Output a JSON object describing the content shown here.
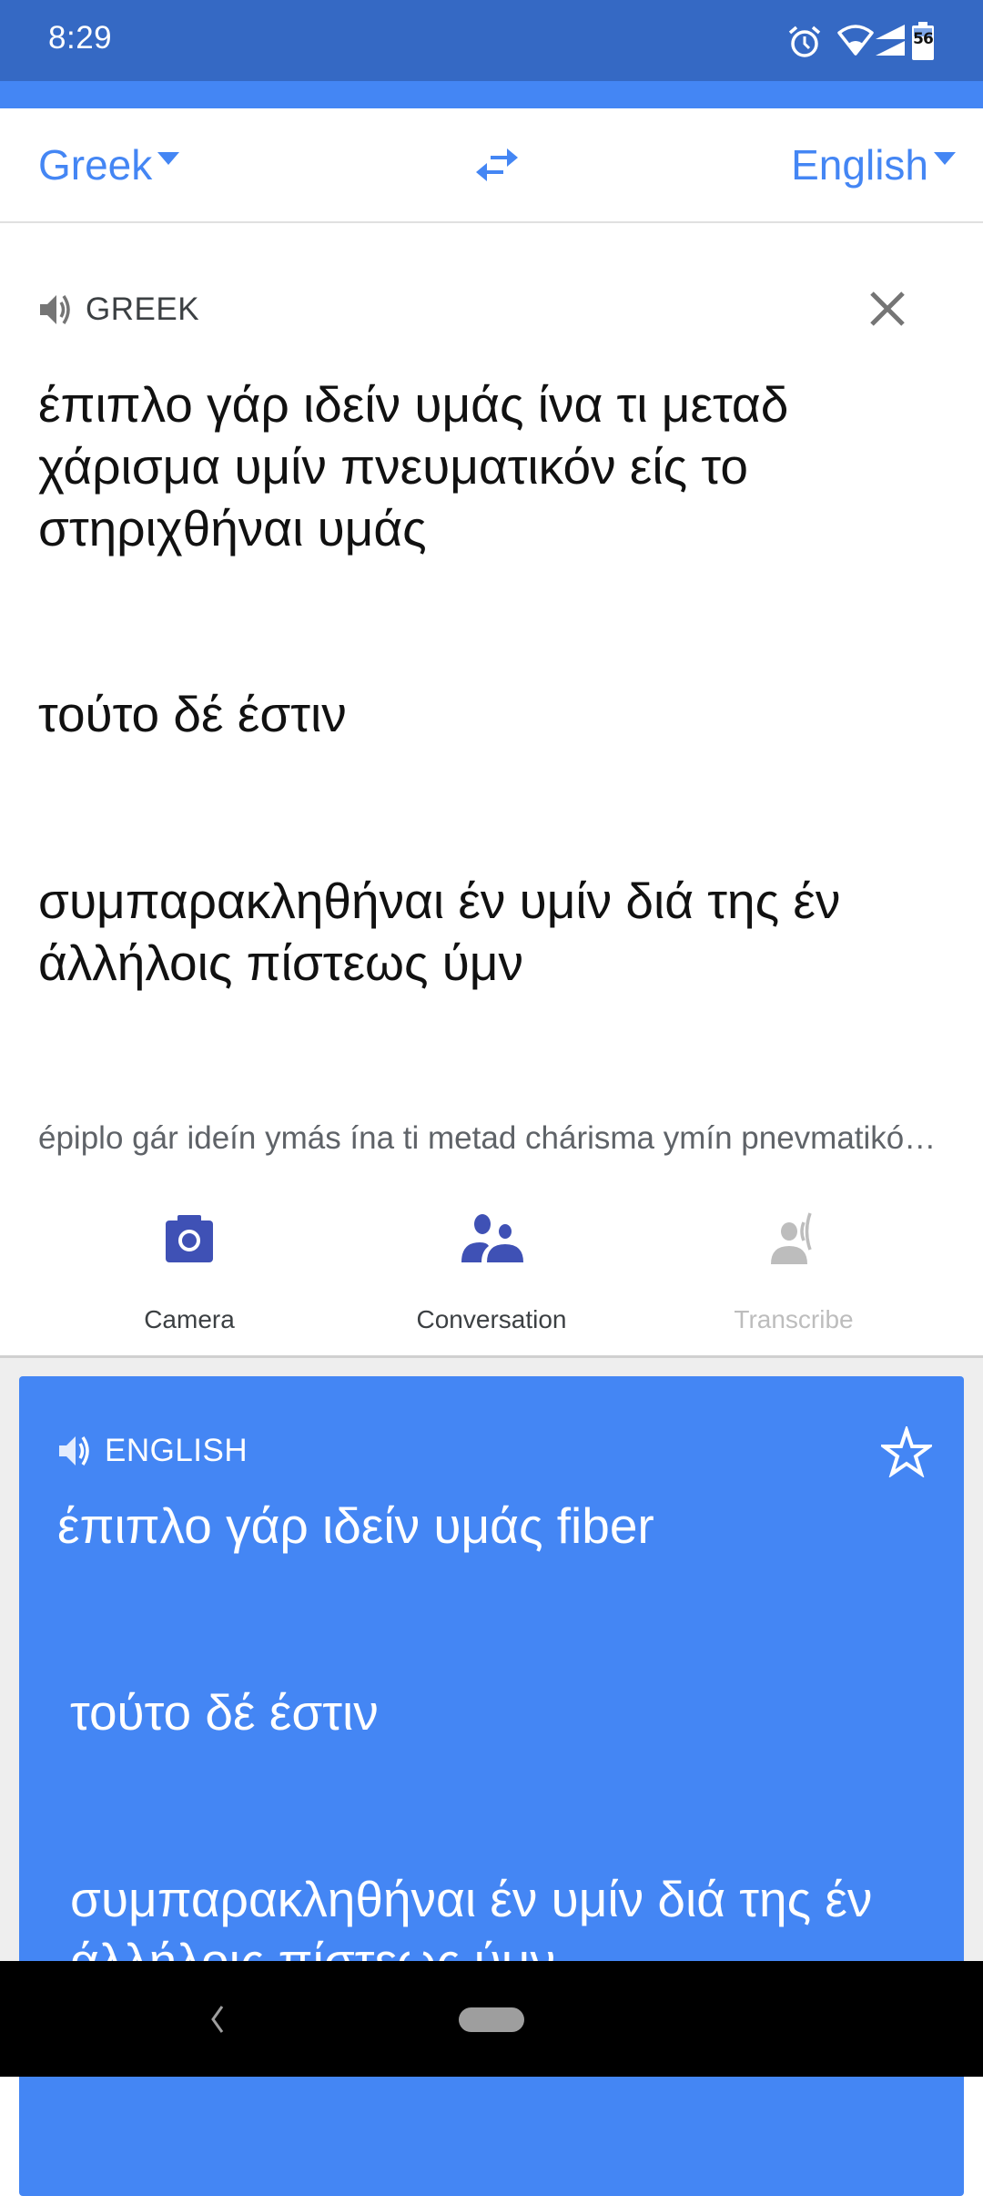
{
  "status_bar": {
    "time": "8:29",
    "battery_level": "56",
    "icons": [
      "alarm-icon",
      "wifi-icon",
      "cell-signal-icon",
      "battery-icon"
    ]
  },
  "language_bar": {
    "source_language": "Greek",
    "target_language": "English",
    "swap_icon": "swap-arrows-icon"
  },
  "source": {
    "label": "GREEK",
    "paragraphs": [
      "έπιπλο γάρ ιδείν υμάς ίνα τι μεταδ χάρισμα υμίν πνευματικόν είς το στηριχθήναι υμάς",
      "τούτο δέ έστιν",
      "συμπαρακληθήναι έν υμίν διά της έν άλλήλοις πίστεως ύμν"
    ],
    "transliteration": "épiplo gár ideín ymás ína ti metad chárisma ymín pnevmatikón eís to stirichthínai ymás"
  },
  "tools": [
    {
      "label": "Camera",
      "icon": "camera-icon",
      "enabled": true
    },
    {
      "label": "Conversation",
      "icon": "conversation-icon",
      "enabled": true
    },
    {
      "label": "Transcribe",
      "icon": "transcribe-icon",
      "enabled": false
    }
  ],
  "translation": {
    "label": "ENGLISH",
    "paragraphs": [
      "έπιπλο γάρ ιδείν υμάς fiber",
      "τούτο δέ έστιν",
      "συμπαρακληθήναι έν υμίν διά της έν άλλήλοις πίστεως ύμν"
    ]
  },
  "colors": {
    "status_bar": "#3569c4",
    "accent": "#4486f4",
    "tool_icon": "#3f51b5",
    "disabled": "#bdbdbd"
  }
}
